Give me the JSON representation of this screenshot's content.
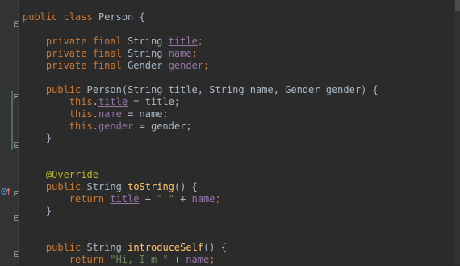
{
  "code": {
    "class_decl": {
      "kw1": "public",
      "kw2": "class",
      "name": "Person",
      "brace": "{"
    },
    "field_title": {
      "kw1": "private",
      "kw2": "final",
      "type": "String",
      "name": "title"
    },
    "field_name": {
      "kw1": "private",
      "kw2": "final",
      "type": "String",
      "name": "name"
    },
    "field_gender": {
      "kw1": "private",
      "kw2": "final",
      "type": "Gender",
      "name": "gender"
    },
    "ctor_decl": {
      "kw": "public",
      "name": "Person",
      "params": "(String title, String name, Gender gender) {"
    },
    "ctor_title": {
      "this": "this",
      "field": "title",
      "rest": " = title;"
    },
    "ctor_name": {
      "this": "this",
      "field": "name",
      "rest": " = name;"
    },
    "ctor_gender": {
      "this": "this",
      "field": "gender",
      "rest": " = gender;"
    },
    "ctor_close": "}",
    "override": "@Override",
    "tostring_decl": {
      "kw": "public",
      "type": "String",
      "name": "toString",
      "rest": "() {"
    },
    "tostring_return": {
      "kw": "return",
      "field1": "title",
      "plus1": " + ",
      "str": "\" \"",
      "plus2": " + ",
      "field2": "name",
      "end": ";"
    },
    "tostring_close": "}",
    "intro_decl": {
      "kw": "public",
      "type": "String",
      "name": "introduceSelf",
      "rest": "() {"
    },
    "intro_return": {
      "kw": "return",
      "str": "\"Hi, I'm \"",
      "plus": " + ",
      "field": "name",
      "end": ";"
    }
  },
  "icons": {
    "override_marker": "override-arrow-up-icon",
    "fold": "fold-marker-icon"
  },
  "colors": {
    "background": "#2b2b2b",
    "text": "#a9b7c6",
    "keyword": "#cc7832",
    "field": "#9876aa",
    "method": "#ffc66d",
    "annotation": "#bbb529",
    "string": "#6a8759"
  }
}
